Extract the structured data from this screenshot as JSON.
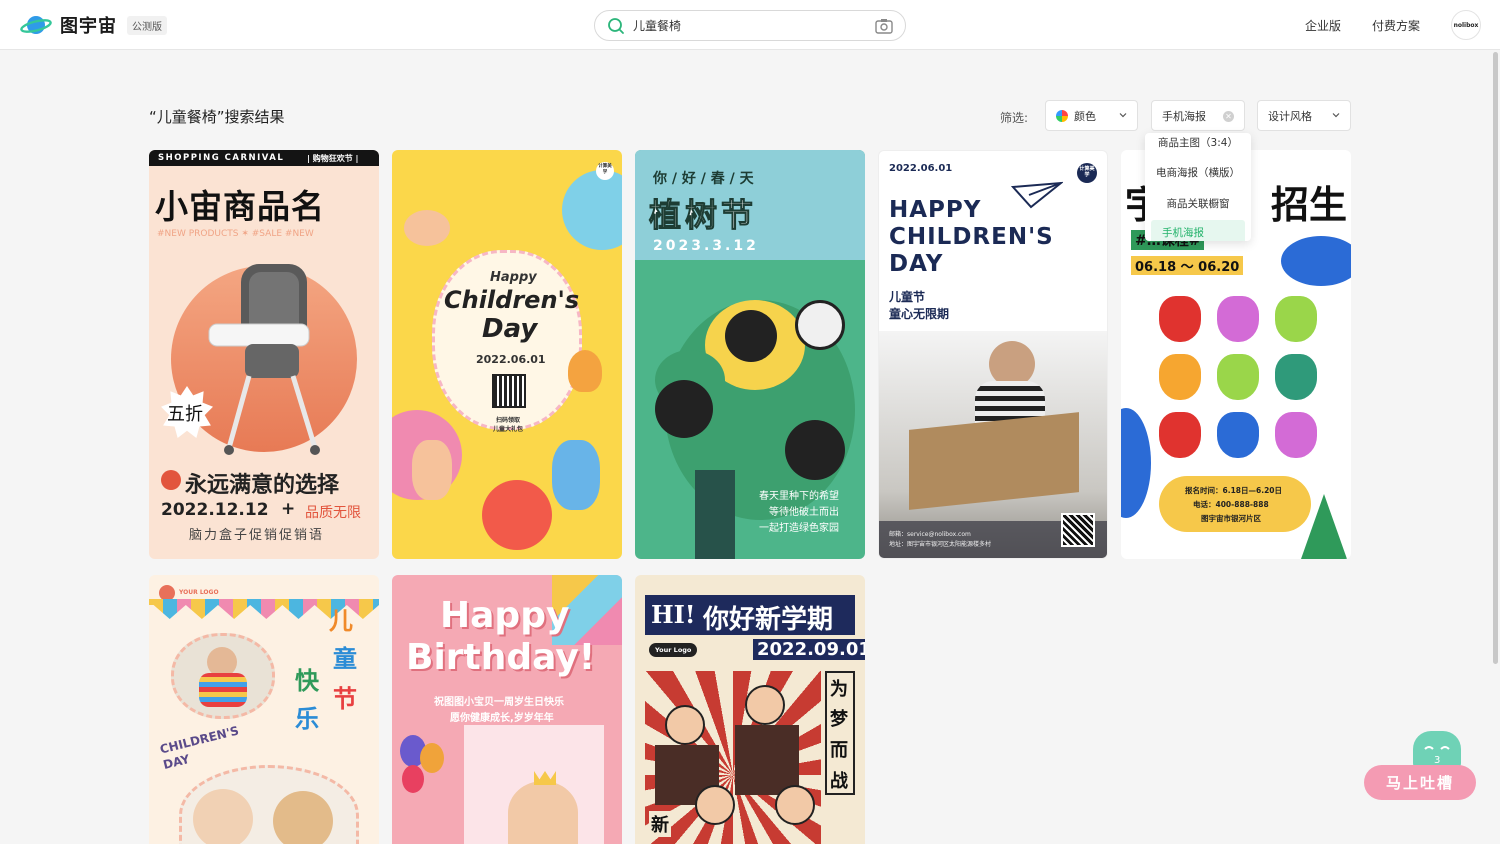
{
  "app": {
    "brand": "图宇宙",
    "badge": "公测版"
  },
  "search": {
    "value": "儿童餐椅"
  },
  "nav": {
    "enterprise": "企业版",
    "pricing": "付费方案",
    "avatar_text": "nolibox"
  },
  "results": {
    "title": "“儿童餐椅”搜索结果"
  },
  "filters": {
    "label": "筛选:",
    "color": "颜色",
    "size": "手机海报",
    "style": "设计风格",
    "dropdown": [
      "商品主图（3:4）",
      "电商海报（横版）",
      "商品关联橱窗",
      "手机海报"
    ]
  },
  "cards": [
    {
      "banner_left": "SHOPPING CARNIVAL",
      "banner_right": "| 购物狂欢节 |",
      "title": "小宙商品名",
      "tags": "#NEW PRODUCTS ✶ #SALE   #NEW",
      "badge": "五折",
      "slogan": "永远满意的选择",
      "date": "2022.12.12",
      "plus": "+",
      "quality": "品质无限",
      "footer": "脑力盒子促销促销语"
    },
    {
      "corner": "计算美学",
      "happy": "Happy",
      "title1": "Children's",
      "title2": "Day",
      "date": "2022.06.01",
      "qr_caption1": "扫码领取",
      "qr_caption2": "儿童大礼包"
    },
    {
      "header": "你 / 好 / 春 / 天",
      "title": "植树节",
      "date": "2023.3.12",
      "line1": "春天里种下的希望",
      "line2": "等待他破土而出",
      "line3": "一起打造绿色家园"
    },
    {
      "date": "2022.06.01",
      "corner": "计算美学",
      "title1": "HAPPY",
      "title2": "CHILDREN'S",
      "title3": "DAY",
      "sub1": "儿童节",
      "sub2": "童心无限期",
      "mail": "邮箱：service@nolibox.com",
      "addr": "地址：图宇宙市银河区太阳能源楼多村"
    },
    {
      "title_left": "宇",
      "title_right": "招生",
      "tag": "#…课程#",
      "date": "06.18 ～ 06.20",
      "info1": "报名时间：6.18日—6.20日",
      "info2": "电话：400-888-888",
      "info3": "图宇宙市银河片区"
    },
    {
      "logo": "YOUR LOGO",
      "c1": "儿",
      "c2": "童",
      "c3": "快",
      "c4": "节",
      "c5": "乐",
      "en1": "CHILDREN'S",
      "en2": "DAY"
    },
    {
      "title1": "Happy",
      "title2": "Birthday!",
      "line1": "祝图图小宝贝一周岁生日快乐",
      "line2": "愿你健康成长,岁岁年年"
    },
    {
      "hi": "HI!",
      "title": "你好新学期",
      "logo": "Your Logo",
      "date": "2022.09.01",
      "v1": "为",
      "v2": "梦",
      "v3": "而",
      "v4": "战",
      "bottom": "新"
    }
  ],
  "feedback": {
    "label": "马上吐槽"
  }
}
